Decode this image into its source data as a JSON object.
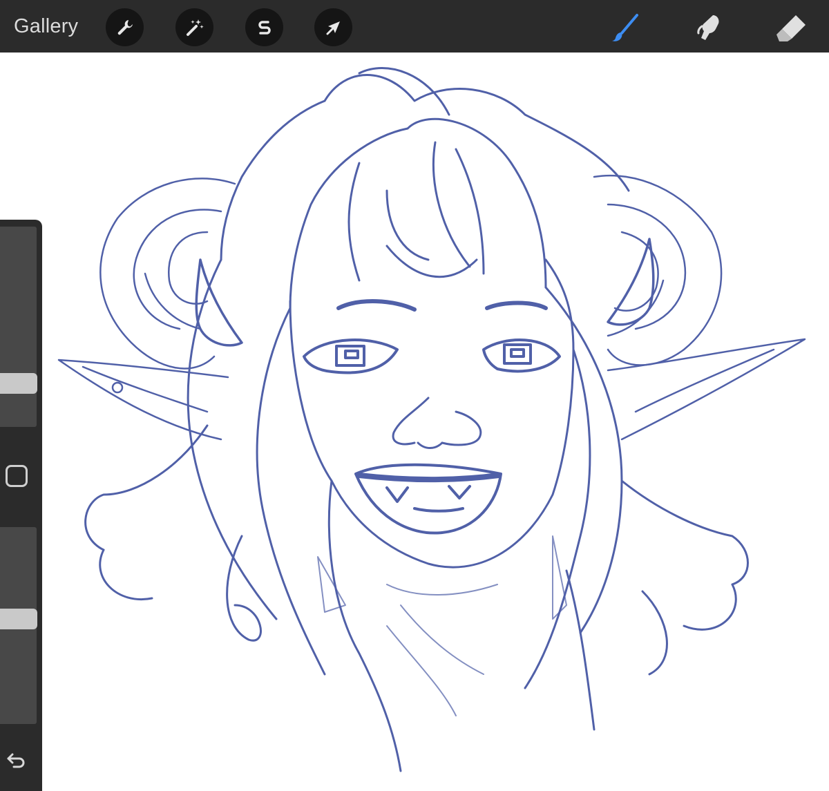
{
  "topbar": {
    "gallery_label": "Gallery",
    "left_tools": [
      {
        "name": "actions",
        "icon": "wrench-icon"
      },
      {
        "name": "adjustments",
        "icon": "magic-wand-icon"
      },
      {
        "name": "selection",
        "icon": "selection-s-icon"
      },
      {
        "name": "transform",
        "icon": "arrow-cursor-icon"
      }
    ],
    "right_tools": [
      {
        "name": "paint",
        "icon": "brush-icon",
        "active": true
      },
      {
        "name": "smudge",
        "icon": "smudge-finger-icon"
      },
      {
        "name": "erase",
        "icon": "eraser-icon"
      }
    ]
  },
  "sidebar": {
    "brush_size_level": 0.25,
    "opacity_level": 0.6,
    "modify_icon": "square-modify-icon",
    "undo_icon": "undo-arrow-icon"
  },
  "colors": {
    "toolbar": "#2b2b2b",
    "tool_circle": "#151515",
    "active_tool": "#3d8df2",
    "sketch_stroke": "#5060a8",
    "canvas": "#ffffff"
  }
}
